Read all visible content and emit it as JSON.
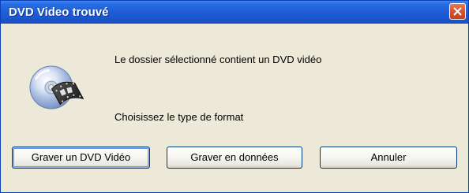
{
  "window": {
    "title": "DVD Video trouvé"
  },
  "titlebar": {
    "close_icon": "close-icon",
    "colors": {
      "titlebar_blue": "#1f5fd8",
      "close_red": "#d9542c"
    }
  },
  "content": {
    "icon": "dvd-film-icon",
    "message_line1": "Le dossier sélectionné contient un DVD vidéo",
    "message_line2": "Choisissez le type de format"
  },
  "buttons": {
    "burn_dvd_video_label": "Graver un DVD Vidéo",
    "burn_data_label": "Graver en données",
    "cancel_label": "Annuler"
  }
}
